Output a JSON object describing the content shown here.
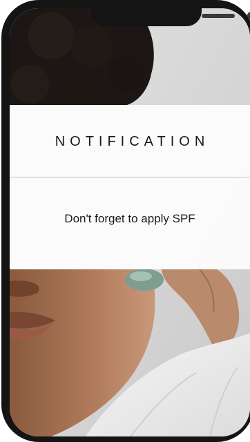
{
  "notification": {
    "title": "NOTIFICATION",
    "message": "Don't forget to apply SPF"
  },
  "colors": {
    "phone_frame": "#141414",
    "card_background": "#fcfcfc",
    "text": "#1a1a1a",
    "divider": "#c8c8c8"
  }
}
